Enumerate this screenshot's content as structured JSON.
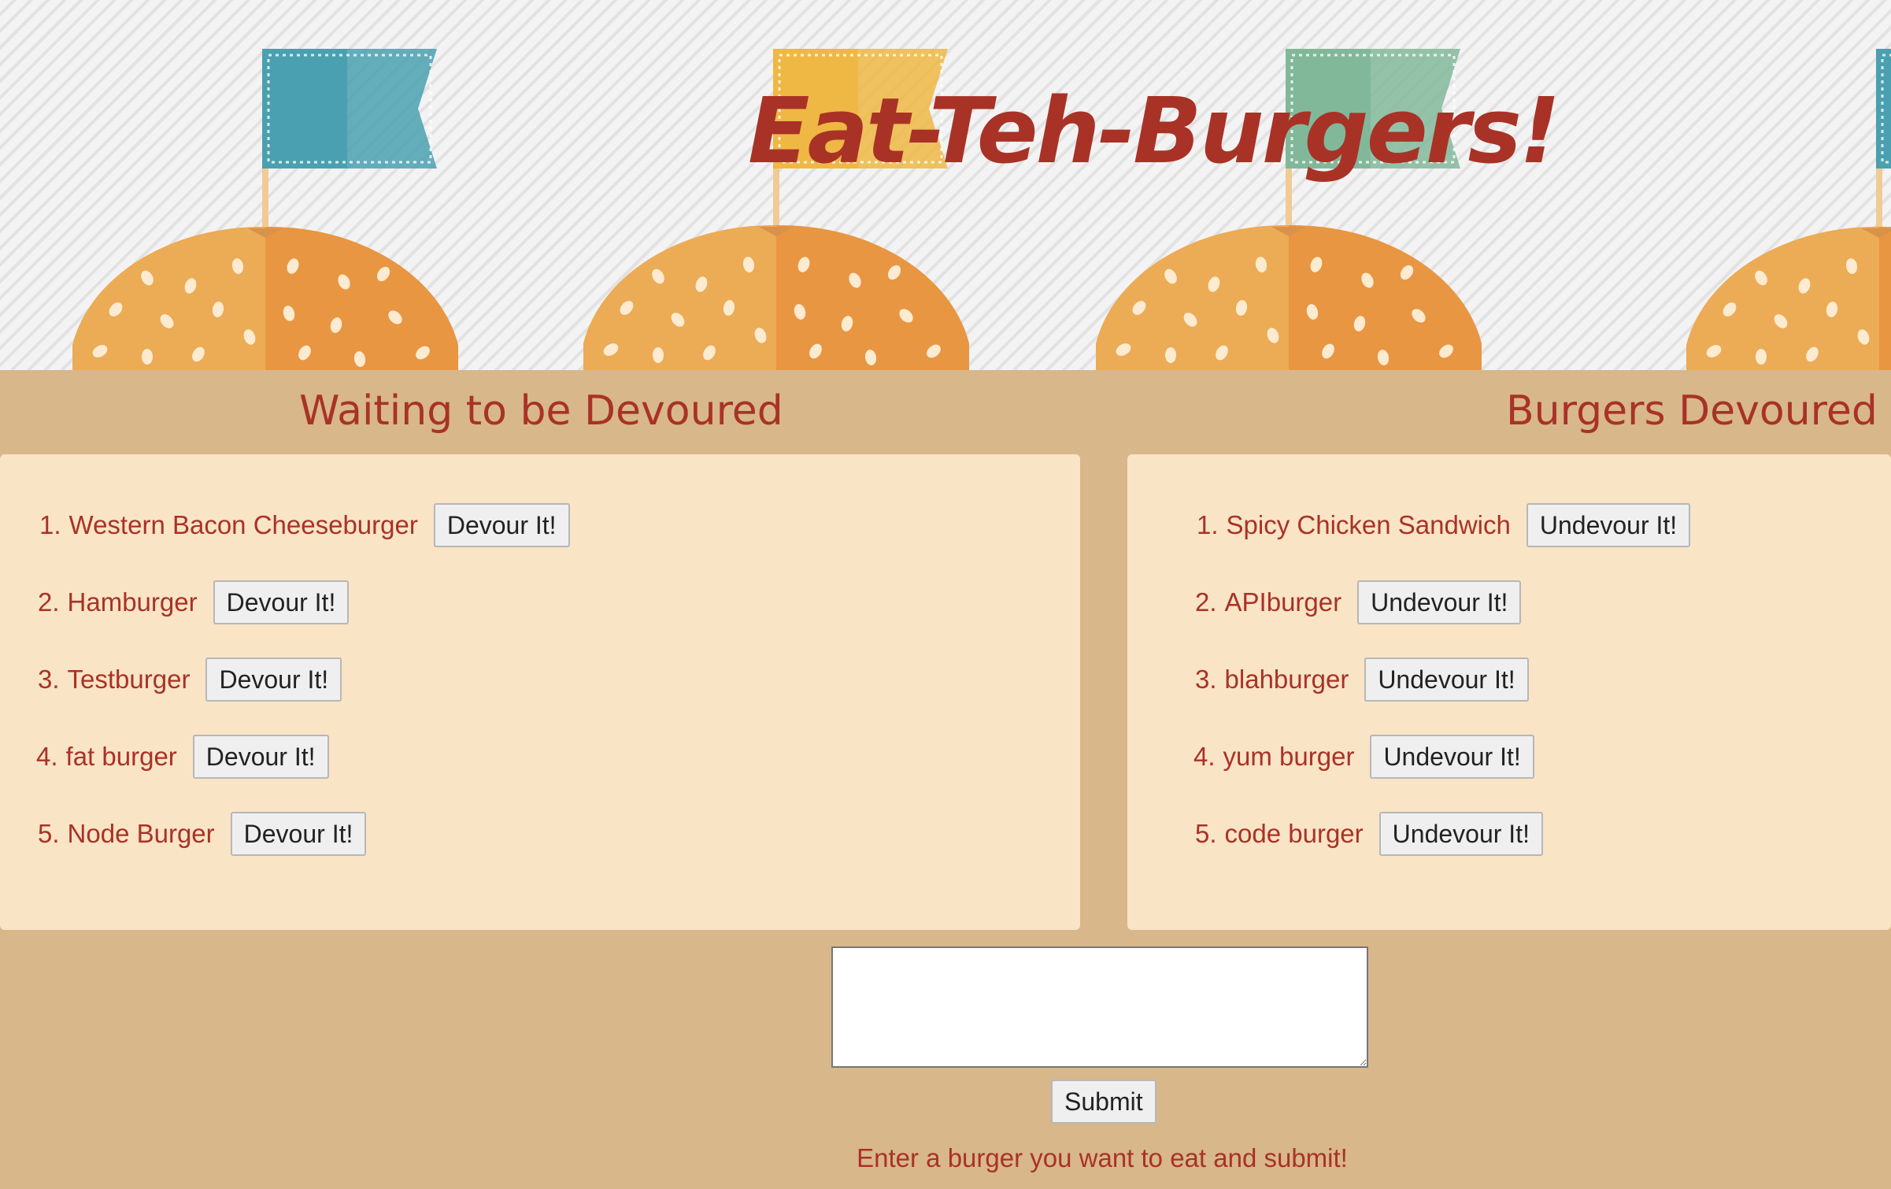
{
  "header": {
    "title": "Eat-Teh-Burgers!"
  },
  "waiting": {
    "heading": "Waiting to be Devoured",
    "button_label": "Devour It!",
    "items": [
      {
        "num": "1.",
        "name": "Western Bacon Cheeseburger"
      },
      {
        "num": "2.",
        "name": "Hamburger"
      },
      {
        "num": "3.",
        "name": "Testburger"
      },
      {
        "num": "4.",
        "name": "fat burger"
      },
      {
        "num": "5.",
        "name": "Node Burger"
      }
    ]
  },
  "devoured": {
    "heading": "Burgers Devoured",
    "button_label": "Undevour It!",
    "items": [
      {
        "num": "1.",
        "name": "Spicy Chicken Sandwich"
      },
      {
        "num": "2.",
        "name": "APIburger"
      },
      {
        "num": "3.",
        "name": "blahburger"
      },
      {
        "num": "4.",
        "name": "yum burger"
      },
      {
        "num": "5.",
        "name": "code burger"
      }
    ]
  },
  "form": {
    "input_value": "",
    "submit_label": "Submit",
    "hint": "Enter a burger you want to eat and submit!"
  },
  "colors": {
    "accent_red": "#a93226",
    "band_tan": "#d8b78b",
    "panel_cream": "#fae4c6",
    "bun_orange": "#eb9a45"
  }
}
